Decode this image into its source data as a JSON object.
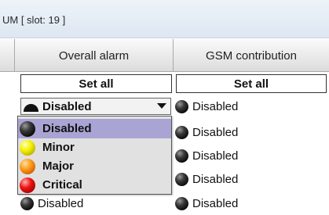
{
  "window": {
    "title": "UM [ slot: 19 ]"
  },
  "table": {
    "columns": [
      "",
      "Overall alarm",
      "GSM contribution"
    ],
    "set_all_label": "Set all",
    "overall_current": {
      "value": "Disabled",
      "icon": "black-alarm-ball"
    },
    "gsm_rows": [
      "Disabled",
      "Disabled",
      "Disabled",
      "Disabled",
      "Disabled"
    ],
    "overall_below_dropdown": "Disabled"
  },
  "dropdown": {
    "options": [
      {
        "label": "Disabled",
        "icon": "black-ball-icon",
        "color": "#000000",
        "selected": true
      },
      {
        "label": "Minor",
        "icon": "yellow-ball-icon",
        "color": "#f5f000",
        "selected": false
      },
      {
        "label": "Major",
        "icon": "orange-ball-icon",
        "color": "#ff9a1a",
        "selected": false
      },
      {
        "label": "Critical",
        "icon": "red-ball-icon",
        "color": "#ee1111",
        "selected": false
      }
    ]
  }
}
